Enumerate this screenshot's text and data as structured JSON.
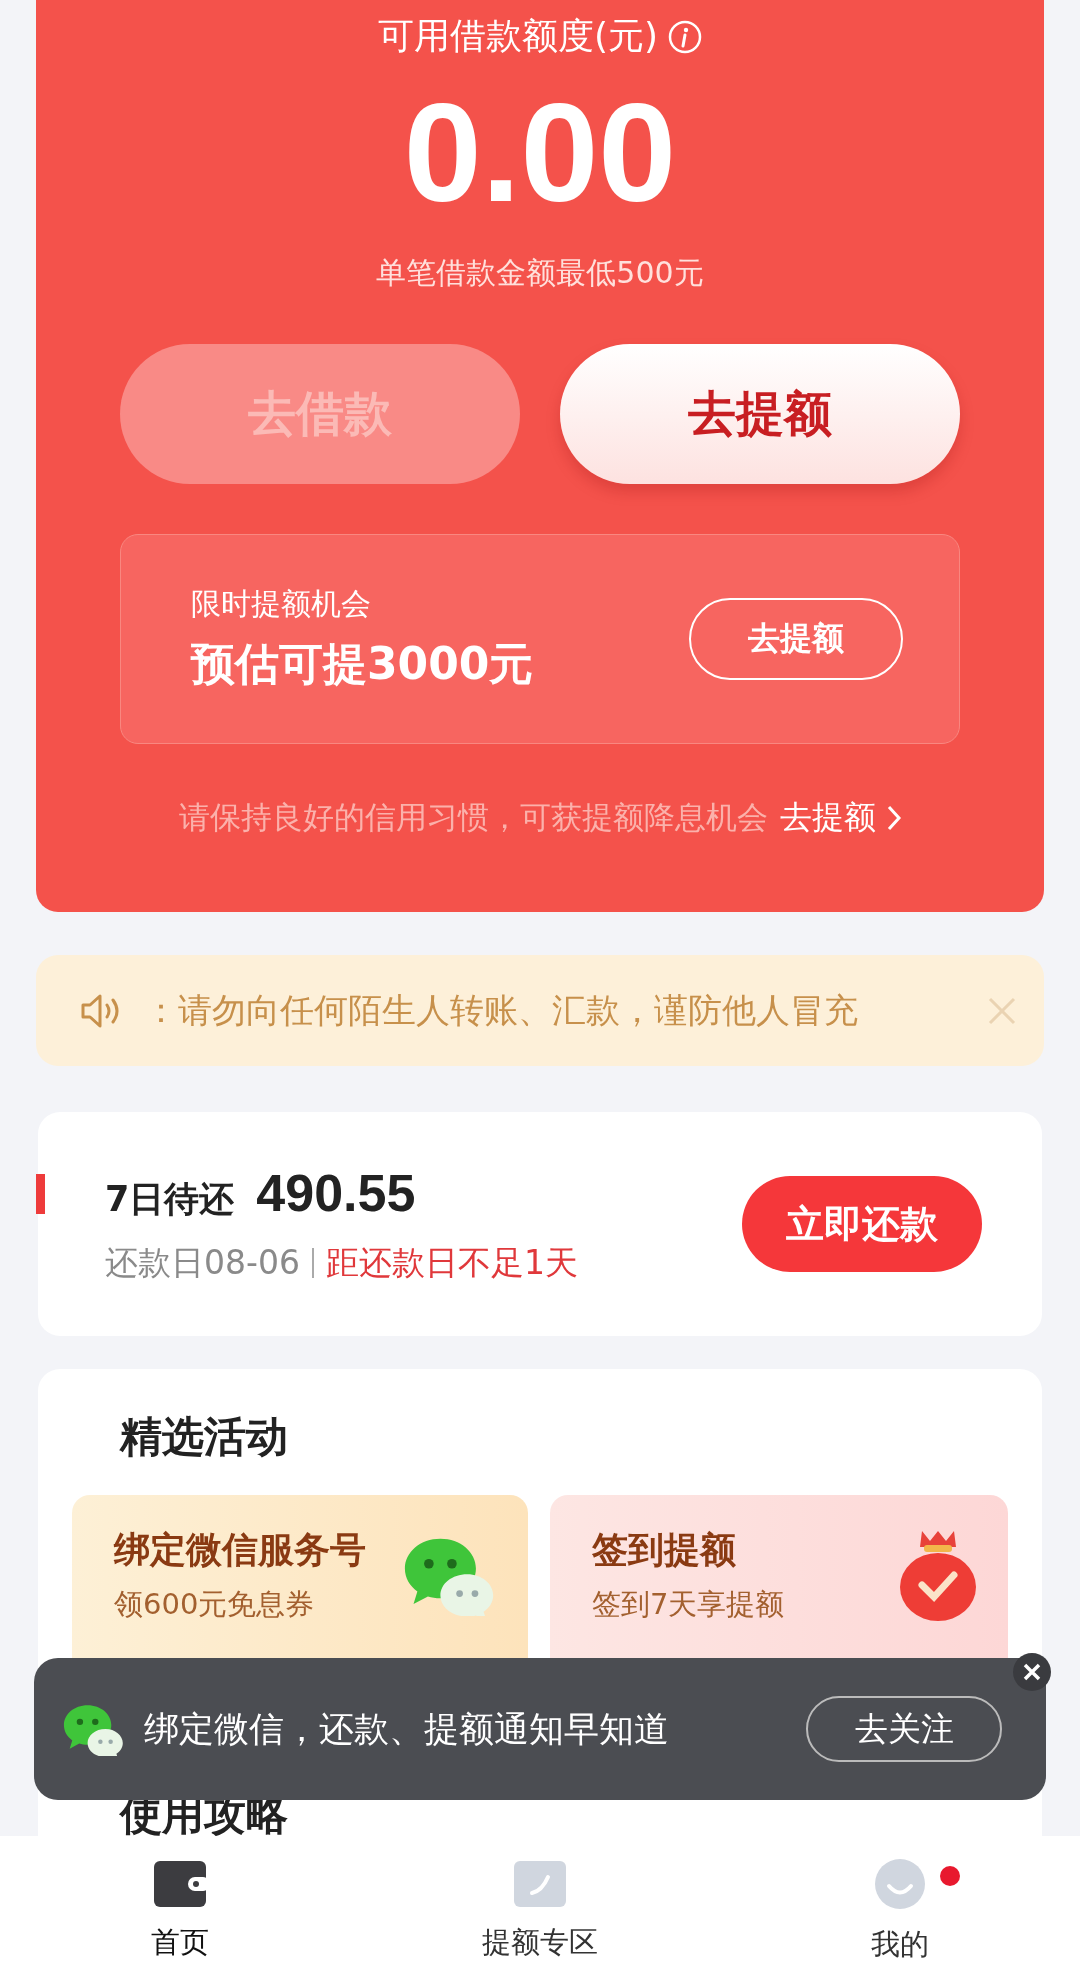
{
  "credit": {
    "label": "可用借款额度(元)",
    "amount": "0.00",
    "min_note": "单笔借款金额最低500元"
  },
  "actions": [
    {
      "label": "去借款",
      "disabled": true
    },
    {
      "label": "去提额",
      "disabled": false
    }
  ],
  "promo": {
    "title": "限时提额机会",
    "estimate": "预估可提3000元",
    "button": "去提额"
  },
  "tip": {
    "text": "请保持良好的信用习惯，可获提额降息机会",
    "link": "去提额"
  },
  "notice": {
    "text": "：请勿向任何陌生人转账、汇款，谨防他人冒充"
  },
  "repay": {
    "label": "7日待还",
    "amount": "490.55",
    "due": "还款日08-06",
    "warning": "距还款日不足1天",
    "button": "立即还款"
  },
  "activities": {
    "title": "精选活动",
    "items": [
      {
        "kind": "wechat",
        "title": "绑定微信服务号",
        "subtitle": "领600元免息券"
      },
      {
        "kind": "gift",
        "title": "签到提额",
        "subtitle": "签到7天享提额"
      }
    ]
  },
  "toast": {
    "text": "绑定微信，还款、提额通知早知道",
    "button": "去关注"
  },
  "guide": {
    "title": "使用攻略"
  },
  "nav": [
    {
      "kind": "wallet",
      "label": "首页",
      "selected": true,
      "badge": false
    },
    {
      "kind": "card",
      "label": "提额专区",
      "selected": false,
      "badge": false
    },
    {
      "kind": "profile",
      "label": "我的",
      "selected": false,
      "badge": true
    }
  ]
}
